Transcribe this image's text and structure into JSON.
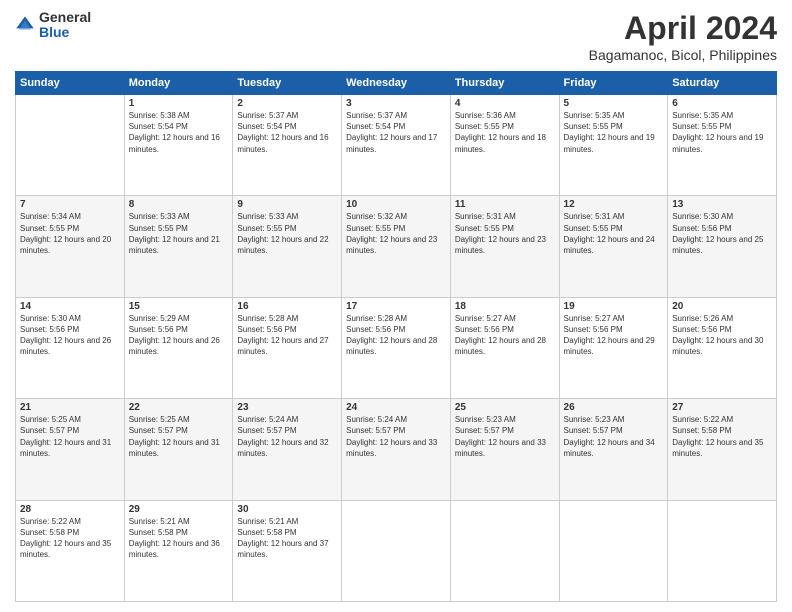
{
  "logo": {
    "general": "General",
    "blue": "Blue"
  },
  "title": "April 2024",
  "location": "Bagamanoc, Bicol, Philippines",
  "headers": [
    "Sunday",
    "Monday",
    "Tuesday",
    "Wednesday",
    "Thursday",
    "Friday",
    "Saturday"
  ],
  "weeks": [
    [
      {
        "day": "",
        "sunrise": "",
        "sunset": "",
        "daylight": ""
      },
      {
        "day": "1",
        "sunrise": "Sunrise: 5:38 AM",
        "sunset": "Sunset: 5:54 PM",
        "daylight": "Daylight: 12 hours and 16 minutes."
      },
      {
        "day": "2",
        "sunrise": "Sunrise: 5:37 AM",
        "sunset": "Sunset: 5:54 PM",
        "daylight": "Daylight: 12 hours and 16 minutes."
      },
      {
        "day": "3",
        "sunrise": "Sunrise: 5:37 AM",
        "sunset": "Sunset: 5:54 PM",
        "daylight": "Daylight: 12 hours and 17 minutes."
      },
      {
        "day": "4",
        "sunrise": "Sunrise: 5:36 AM",
        "sunset": "Sunset: 5:55 PM",
        "daylight": "Daylight: 12 hours and 18 minutes."
      },
      {
        "day": "5",
        "sunrise": "Sunrise: 5:35 AM",
        "sunset": "Sunset: 5:55 PM",
        "daylight": "Daylight: 12 hours and 19 minutes."
      },
      {
        "day": "6",
        "sunrise": "Sunrise: 5:35 AM",
        "sunset": "Sunset: 5:55 PM",
        "daylight": "Daylight: 12 hours and 19 minutes."
      }
    ],
    [
      {
        "day": "7",
        "sunrise": "Sunrise: 5:34 AM",
        "sunset": "Sunset: 5:55 PM",
        "daylight": "Daylight: 12 hours and 20 minutes."
      },
      {
        "day": "8",
        "sunrise": "Sunrise: 5:33 AM",
        "sunset": "Sunset: 5:55 PM",
        "daylight": "Daylight: 12 hours and 21 minutes."
      },
      {
        "day": "9",
        "sunrise": "Sunrise: 5:33 AM",
        "sunset": "Sunset: 5:55 PM",
        "daylight": "Daylight: 12 hours and 22 minutes."
      },
      {
        "day": "10",
        "sunrise": "Sunrise: 5:32 AM",
        "sunset": "Sunset: 5:55 PM",
        "daylight": "Daylight: 12 hours and 23 minutes."
      },
      {
        "day": "11",
        "sunrise": "Sunrise: 5:31 AM",
        "sunset": "Sunset: 5:55 PM",
        "daylight": "Daylight: 12 hours and 23 minutes."
      },
      {
        "day": "12",
        "sunrise": "Sunrise: 5:31 AM",
        "sunset": "Sunset: 5:55 PM",
        "daylight": "Daylight: 12 hours and 24 minutes."
      },
      {
        "day": "13",
        "sunrise": "Sunrise: 5:30 AM",
        "sunset": "Sunset: 5:56 PM",
        "daylight": "Daylight: 12 hours and 25 minutes."
      }
    ],
    [
      {
        "day": "14",
        "sunrise": "Sunrise: 5:30 AM",
        "sunset": "Sunset: 5:56 PM",
        "daylight": "Daylight: 12 hours and 26 minutes."
      },
      {
        "day": "15",
        "sunrise": "Sunrise: 5:29 AM",
        "sunset": "Sunset: 5:56 PM",
        "daylight": "Daylight: 12 hours and 26 minutes."
      },
      {
        "day": "16",
        "sunrise": "Sunrise: 5:28 AM",
        "sunset": "Sunset: 5:56 PM",
        "daylight": "Daylight: 12 hours and 27 minutes."
      },
      {
        "day": "17",
        "sunrise": "Sunrise: 5:28 AM",
        "sunset": "Sunset: 5:56 PM",
        "daylight": "Daylight: 12 hours and 28 minutes."
      },
      {
        "day": "18",
        "sunrise": "Sunrise: 5:27 AM",
        "sunset": "Sunset: 5:56 PM",
        "daylight": "Daylight: 12 hours and 28 minutes."
      },
      {
        "day": "19",
        "sunrise": "Sunrise: 5:27 AM",
        "sunset": "Sunset: 5:56 PM",
        "daylight": "Daylight: 12 hours and 29 minutes."
      },
      {
        "day": "20",
        "sunrise": "Sunrise: 5:26 AM",
        "sunset": "Sunset: 5:56 PM",
        "daylight": "Daylight: 12 hours and 30 minutes."
      }
    ],
    [
      {
        "day": "21",
        "sunrise": "Sunrise: 5:25 AM",
        "sunset": "Sunset: 5:57 PM",
        "daylight": "Daylight: 12 hours and 31 minutes."
      },
      {
        "day": "22",
        "sunrise": "Sunrise: 5:25 AM",
        "sunset": "Sunset: 5:57 PM",
        "daylight": "Daylight: 12 hours and 31 minutes."
      },
      {
        "day": "23",
        "sunrise": "Sunrise: 5:24 AM",
        "sunset": "Sunset: 5:57 PM",
        "daylight": "Daylight: 12 hours and 32 minutes."
      },
      {
        "day": "24",
        "sunrise": "Sunrise: 5:24 AM",
        "sunset": "Sunset: 5:57 PM",
        "daylight": "Daylight: 12 hours and 33 minutes."
      },
      {
        "day": "25",
        "sunrise": "Sunrise: 5:23 AM",
        "sunset": "Sunset: 5:57 PM",
        "daylight": "Daylight: 12 hours and 33 minutes."
      },
      {
        "day": "26",
        "sunrise": "Sunrise: 5:23 AM",
        "sunset": "Sunset: 5:57 PM",
        "daylight": "Daylight: 12 hours and 34 minutes."
      },
      {
        "day": "27",
        "sunrise": "Sunrise: 5:22 AM",
        "sunset": "Sunset: 5:58 PM",
        "daylight": "Daylight: 12 hours and 35 minutes."
      }
    ],
    [
      {
        "day": "28",
        "sunrise": "Sunrise: 5:22 AM",
        "sunset": "Sunset: 5:58 PM",
        "daylight": "Daylight: 12 hours and 35 minutes."
      },
      {
        "day": "29",
        "sunrise": "Sunrise: 5:21 AM",
        "sunset": "Sunset: 5:58 PM",
        "daylight": "Daylight: 12 hours and 36 minutes."
      },
      {
        "day": "30",
        "sunrise": "Sunrise: 5:21 AM",
        "sunset": "Sunset: 5:58 PM",
        "daylight": "Daylight: 12 hours and 37 minutes."
      },
      {
        "day": "",
        "sunrise": "",
        "sunset": "",
        "daylight": ""
      },
      {
        "day": "",
        "sunrise": "",
        "sunset": "",
        "daylight": ""
      },
      {
        "day": "",
        "sunrise": "",
        "sunset": "",
        "daylight": ""
      },
      {
        "day": "",
        "sunrise": "",
        "sunset": "",
        "daylight": ""
      }
    ]
  ]
}
